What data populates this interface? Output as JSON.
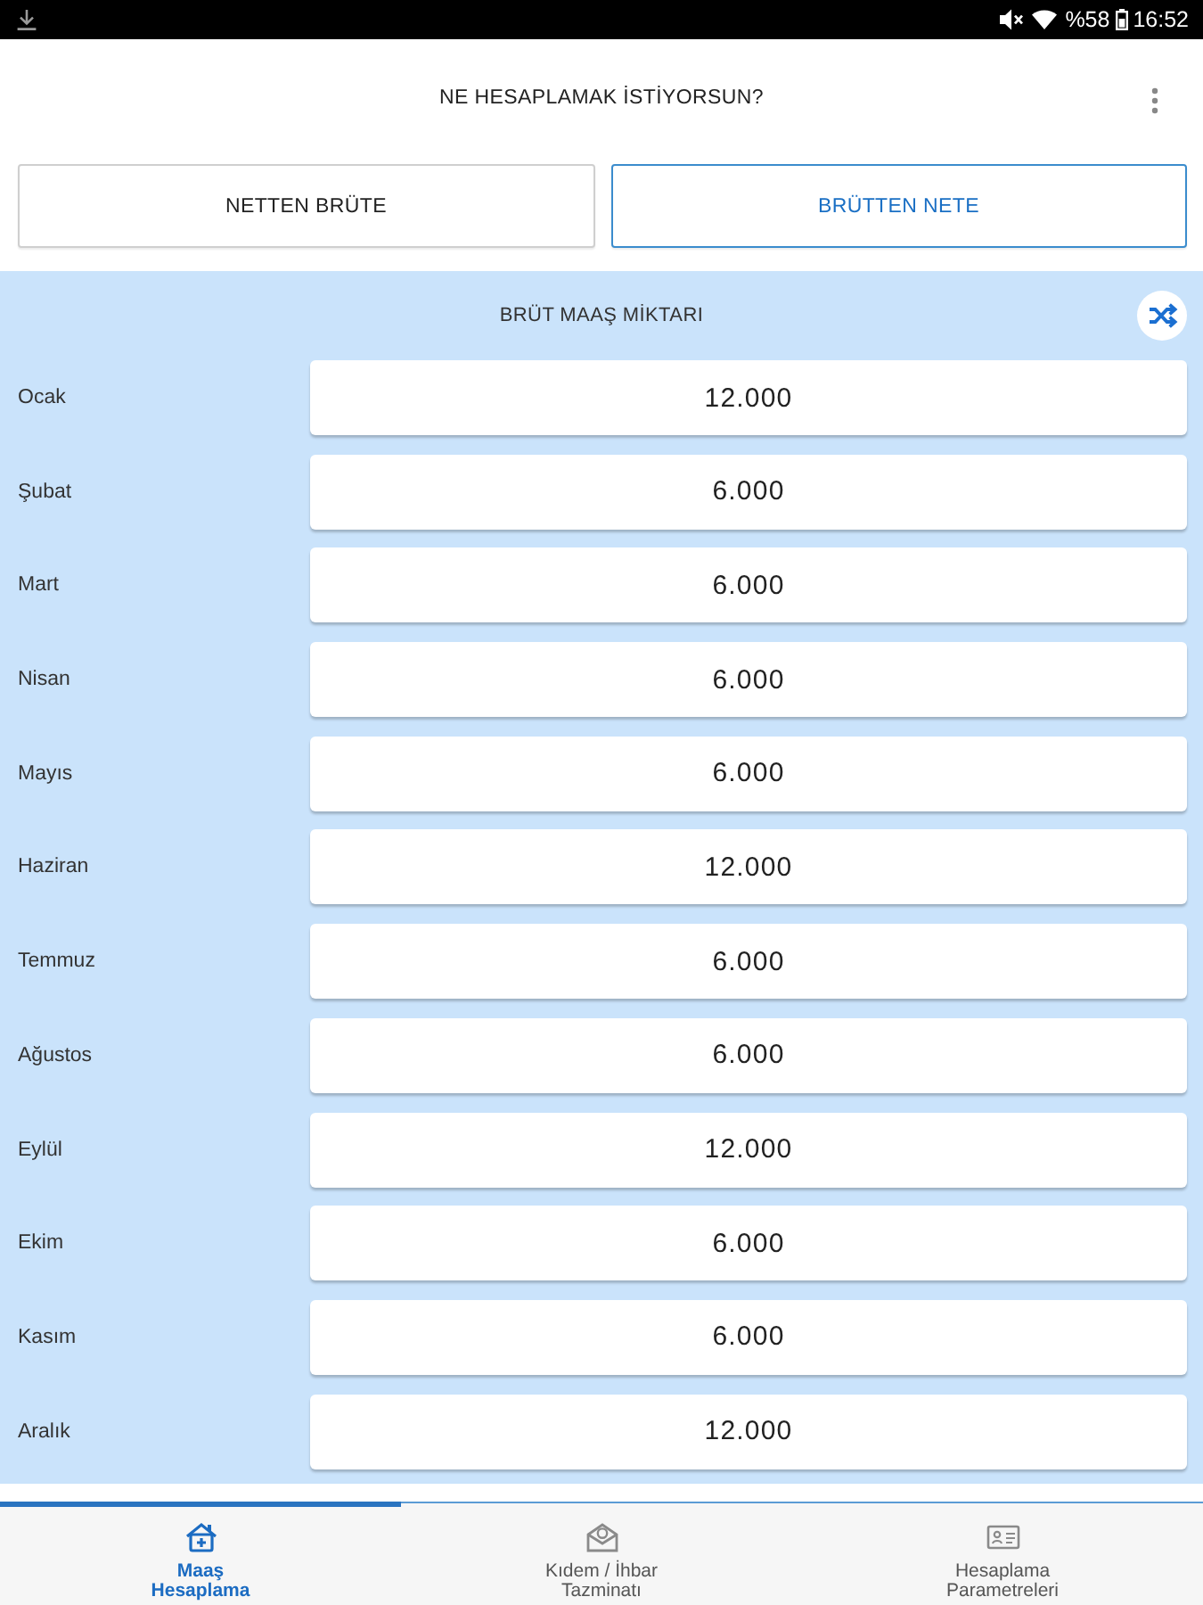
{
  "status_bar": {
    "battery": "%58",
    "time": "16:52"
  },
  "header": {
    "title": "NE HESAPLAMAK İSTİYORSUN?"
  },
  "modes": [
    {
      "label": "NETTEN BRÜTE",
      "selected": false
    },
    {
      "label": "BRÜTTEN NETE",
      "selected": true
    }
  ],
  "salary_panel": {
    "title": "BRÜT MAAŞ MİKTARI",
    "months": [
      {
        "label": "Ocak",
        "value": "12.000"
      },
      {
        "label": "Şubat",
        "value": "6.000"
      },
      {
        "label": "Mart",
        "value": "6.000"
      },
      {
        "label": "Nisan",
        "value": "6.000"
      },
      {
        "label": "Mayıs",
        "value": "6.000"
      },
      {
        "label": "Haziran",
        "value": "12.000"
      },
      {
        "label": "Temmuz",
        "value": "6.000"
      },
      {
        "label": "Ağustos",
        "value": "6.000"
      },
      {
        "label": "Eylül",
        "value": "12.000"
      },
      {
        "label": "Ekim",
        "value": "6.000"
      },
      {
        "label": "Kasım",
        "value": "6.000"
      },
      {
        "label": "Aralık",
        "value": "12.000"
      }
    ]
  },
  "bottom_nav": [
    {
      "kind": "salary",
      "label": "Maaş Hesaplama",
      "selected": true
    },
    {
      "kind": "severance",
      "label": "Kıdem / İhbar Tazminatı",
      "selected": false
    },
    {
      "kind": "parameters",
      "label": "Hesaplama Parametreleri",
      "selected": false
    }
  ]
}
